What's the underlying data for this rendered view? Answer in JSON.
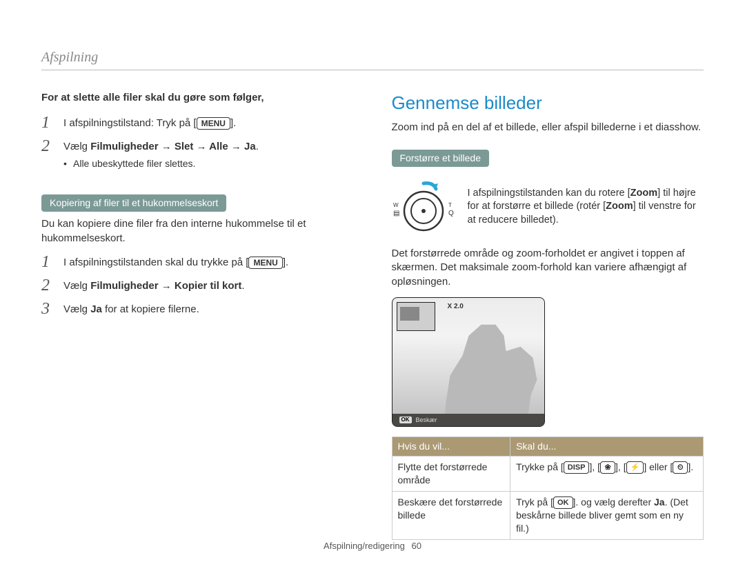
{
  "header": "Afspilning",
  "left": {
    "lead": "For at slette alle filer skal du gøre som følger,",
    "steps1": [
      {
        "n": "1",
        "pre": "I afspilningstilstand: Tryk på [",
        "icon": "MENU",
        "post": "]."
      },
      {
        "n": "2",
        "pre": "Vælg ",
        "bold": "Filmuligheder → Slet → Alle → Ja",
        "post": ".",
        "bullet": "Alle ubeskyttede filer slettes."
      }
    ],
    "pill1": "Kopiering af filer til et hukommelseskort",
    "pill1_desc": "Du kan kopiere dine filer fra den interne hukommelse til et hukommelseskort.",
    "steps2": [
      {
        "n": "1",
        "pre": "I afspilningstilstanden skal du trykke på [",
        "icon": "MENU",
        "post": "]."
      },
      {
        "n": "2",
        "pre": "Vælg ",
        "bold": "Filmuligheder → Kopier til kort",
        "post": "."
      },
      {
        "n": "3",
        "pre": "Vælg ",
        "bold": "Ja",
        "post": " for at kopiere filerne."
      }
    ]
  },
  "right": {
    "title": "Gennemse billeder",
    "intro": "Zoom ind på en del af et billede, eller afspil billederne i et diasshow.",
    "pill": "Forstørre et billede",
    "zoom_desc_a": "I afspilningstilstanden kan du rotere [",
    "zoom_desc_b": "] til højre for at forstørre et billede (rotér [",
    "zoom_desc_c": "] til venstre for at reducere billedet).",
    "zoom_bold": "Zoom",
    "para2": "Det forstørrede område og zoom-forholdet er angivet i toppen af skærmen. Det maksimale zoom-forhold kan variere afhængigt af opløsningen.",
    "view": {
      "zoom_label": "X 2.0",
      "ok": "OK",
      "bar_label": "Beskær"
    },
    "table": {
      "col1": "Hvis du vil...",
      "col2": "Skal du...",
      "row1a": "Flytte det forstørrede område",
      "row1b_pre": "Trykke på [",
      "row1b_disp": "DISP",
      "row1b_mid1": "], [",
      "row1b_mid2": "], [",
      "row1b_mid3": "] eller [",
      "row1b_post": "].",
      "row2a": "Beskære det forstørrede billede",
      "row2b_pre": "Tryk på [",
      "row2b_ok": "OK",
      "row2b_mid": "]. og vælg derefter ",
      "row2b_ja": "Ja",
      "row2b_post": ". (Det beskårne billede bliver gemt som en ny fil.)"
    }
  },
  "footer": {
    "label": "Afspilning/redigering",
    "page": "60"
  }
}
